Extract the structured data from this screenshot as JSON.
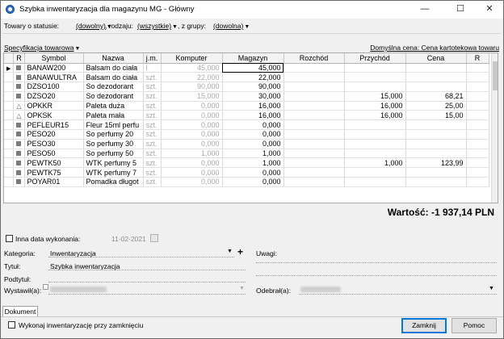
{
  "window": {
    "title": "Szybka inwentaryzacja dla magazynu MG - Główny",
    "minimize": "—",
    "maximize": "☐",
    "close": "✕"
  },
  "filters": {
    "status_label": "Towary o statusie:",
    "status_value": "(dowolny)",
    "kind_label": ", rodzaju:",
    "kind_value": "(wszystkie)",
    "group_label": ", z grupy:",
    "group_value": "(dowolna)"
  },
  "spec_label": "Specyfikacja towarowa",
  "default_price_link": "Domyślna cena: Cena kartotekowa towaru",
  "grid": {
    "columns": [
      "R",
      "Symbol",
      "Nazwa",
      "j.m.",
      "Komputer",
      "Magazyn",
      "Rozchód",
      "Przychód",
      "Cena",
      "R"
    ],
    "rows": [
      {
        "marker": "square",
        "current": true,
        "symbol": "BANAW200",
        "name": "Balsam do ciała",
        "unit": "l",
        "computer": "45,000",
        "store": "45,000",
        "out": "",
        "in": "",
        "price": ""
      },
      {
        "marker": "square",
        "current": false,
        "symbol": "BANAWULTRA",
        "name": "Balsam do ciała",
        "unit": "szt.",
        "computer": "22,000",
        "store": "22,000",
        "out": "",
        "in": "",
        "price": ""
      },
      {
        "marker": "square",
        "current": false,
        "symbol": "DZSO100",
        "name": "So dezodorant",
        "unit": "szt.",
        "computer": "90,000",
        "store": "90,000",
        "out": "",
        "in": "",
        "price": ""
      },
      {
        "marker": "square",
        "current": false,
        "symbol": "DZSO20",
        "name": "So dezodorant",
        "unit": "szt.",
        "computer": "15,000",
        "store": "30,000",
        "out": "",
        "in": "15,000",
        "price": "68,21"
      },
      {
        "marker": "triangle",
        "current": false,
        "symbol": "OPKKR",
        "name": "Paleta duża",
        "unit": "szt.",
        "computer": "0,000",
        "store": "16,000",
        "out": "",
        "in": "16,000",
        "price": "25,00"
      },
      {
        "marker": "triangle",
        "current": false,
        "symbol": "OPKSK",
        "name": "Paleta mała",
        "unit": "szt.",
        "computer": "0,000",
        "store": "16,000",
        "out": "",
        "in": "16,000",
        "price": "15,00"
      },
      {
        "marker": "square",
        "current": false,
        "symbol": "PEFLEUR15",
        "name": "Fleur 15ml perfu",
        "unit": "szt.",
        "computer": "0,000",
        "store": "0,000",
        "out": "",
        "in": "",
        "price": ""
      },
      {
        "marker": "square",
        "current": false,
        "symbol": "PESO20",
        "name": "So perfumy 20",
        "unit": "szt.",
        "computer": "0,000",
        "store": "0,000",
        "out": "",
        "in": "",
        "price": ""
      },
      {
        "marker": "square",
        "current": false,
        "symbol": "PESO30",
        "name": "So perfumy 30",
        "unit": "szt.",
        "computer": "0,000",
        "store": "0,000",
        "out": "",
        "in": "",
        "price": ""
      },
      {
        "marker": "square",
        "current": false,
        "symbol": "PESO50",
        "name": "So perfumy 50",
        "unit": "szt.",
        "computer": "1,000",
        "store": "1,000",
        "out": "",
        "in": "",
        "price": ""
      },
      {
        "marker": "square",
        "current": false,
        "symbol": "PEWTK50",
        "name": "WTK perfumy 5",
        "unit": "szt.",
        "computer": "0,000",
        "store": "1,000",
        "out": "",
        "in": "1,000",
        "price": "123,99"
      },
      {
        "marker": "square",
        "current": false,
        "symbol": "PEWTK75",
        "name": "WTK perfumy 7",
        "unit": "szt.",
        "computer": "0,000",
        "store": "0,000",
        "out": "",
        "in": "",
        "price": ""
      },
      {
        "marker": "square",
        "current": false,
        "symbol": "POYAR01",
        "name": "Pomadka długot",
        "unit": "szt.",
        "computer": "0,000",
        "store": "0,000",
        "out": "",
        "in": "",
        "price": ""
      }
    ]
  },
  "total": "Wartość: -1 937,14 PLN",
  "form": {
    "other_date_label": "Inna data wykonania:",
    "other_date_value": "11-02-2021",
    "category_label": "Kategoria:",
    "category_value": "Inwentaryzacja",
    "category_add": "+",
    "title_label": "Tytuł:",
    "title_value": "Szybka inwentaryzacja",
    "subtitle_label": "Podtytuł:",
    "issued_label": "Wystawił(a):",
    "remarks_label": "Uwagi:",
    "received_label": "Odebrał(a):"
  },
  "tab": "Dokument",
  "bottom": {
    "execute_on_close": "Wykonaj inwentaryzację przy zamknięciu",
    "ok": "Zamknij",
    "help": "Pomoc"
  }
}
